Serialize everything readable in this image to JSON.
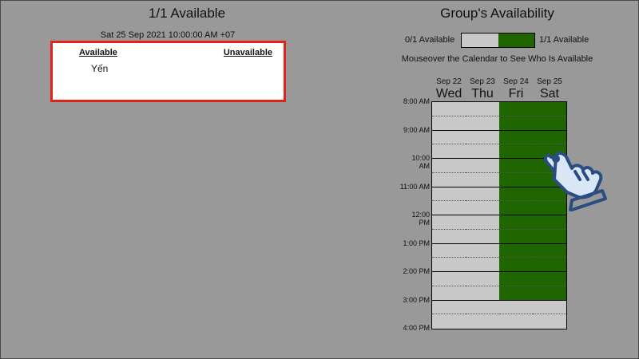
{
  "left_panel": {
    "title": "1/1 Available",
    "date": "Sat 25 Sep 2021 10:00:00 AM +07",
    "available_header": "Available",
    "unavailable_header": "Unavailable",
    "available_people": [
      "Yến"
    ]
  },
  "right_panel": {
    "title": "Group's Availability",
    "legend_min": "0/1 Available",
    "legend_max": "1/1 Available",
    "hint": "Mouseover the Calendar to See Who Is Available",
    "colors": {
      "available": "#1f6600",
      "unavailable": "#c8c8c8"
    },
    "days": [
      {
        "date": "Sep 22",
        "name": "Wed"
      },
      {
        "date": "Sep 23",
        "name": "Thu"
      },
      {
        "date": "Sep 24",
        "name": "Fri"
      },
      {
        "date": "Sep 25",
        "name": "Sat"
      }
    ],
    "time_labels": [
      "8:00 AM",
      "9:00 AM",
      "10:00 AM",
      "11:00 AM",
      "12:00 PM",
      "1:00 PM",
      "2:00 PM",
      "3:00 PM",
      "4:00 PM"
    ],
    "availability": [
      [
        0,
        0,
        0,
        0,
        0,
        0,
        0,
        0,
        0,
        0,
        0,
        0,
        0,
        0,
        0,
        0
      ],
      [
        0,
        0,
        0,
        0,
        0,
        0,
        0,
        0,
        0,
        0,
        0,
        0,
        0,
        0,
        0,
        0
      ],
      [
        1,
        1,
        1,
        1,
        1,
        1,
        1,
        1,
        1,
        1,
        1,
        1,
        1,
        1,
        0,
        0
      ],
      [
        1,
        1,
        1,
        1,
        1,
        1,
        1,
        1,
        1,
        1,
        1,
        1,
        1,
        1,
        0,
        0
      ]
    ]
  }
}
